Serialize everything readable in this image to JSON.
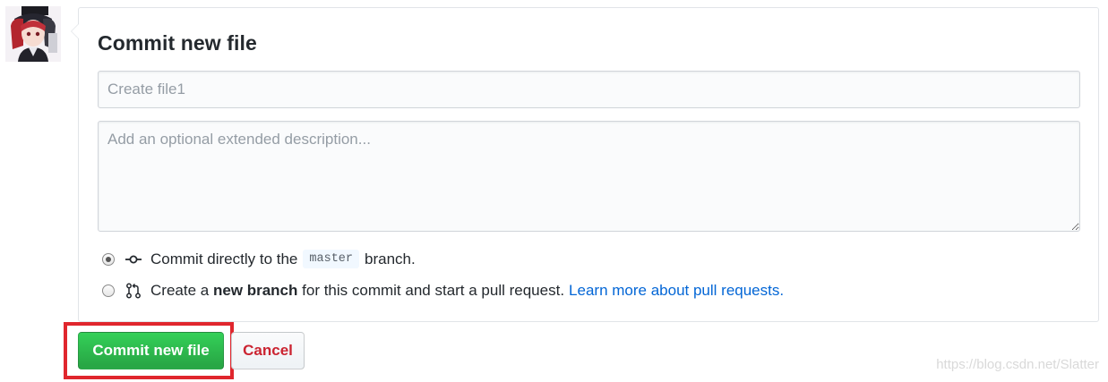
{
  "user": {
    "avatar_icon": "anime-avatar-icon"
  },
  "commit_form": {
    "title": "Commit new file",
    "summary_placeholder": "Create file1",
    "summary_value": "",
    "description_placeholder": "Add an optional extended description...",
    "description_value": ""
  },
  "options": {
    "direct": {
      "selected": true,
      "icon": "git-commit-icon",
      "text_before": "Commit directly to the",
      "branch": "master",
      "text_after": "branch."
    },
    "new_branch": {
      "selected": false,
      "icon": "git-pull-request-icon",
      "text_before": "Create a",
      "bold_text": "new branch",
      "text_after": "for this commit and start a pull request.",
      "link_text": "Learn more about pull requests."
    }
  },
  "actions": {
    "commit_label": "Commit new file",
    "cancel_label": "Cancel"
  },
  "watermark": "https://blog.csdn.net/Slatter",
  "colors": {
    "primary_green": "#28a745",
    "cancel_red": "#cb2431",
    "link_blue": "#0366d6",
    "highlight_red": "#e0262d"
  }
}
